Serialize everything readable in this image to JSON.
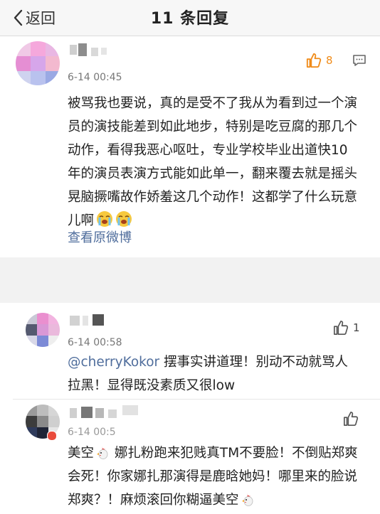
{
  "header": {
    "back_label": "返回",
    "title": "11 条回复"
  },
  "main_comment": {
    "time": "6-14 00:45",
    "likes": "8",
    "text": "被骂我也要说，真的是受不了我从为看到过一个演员的演技能差到如此地步，特别是吃豆腐的那几个动作，看得我恶心呕吐，专业学校毕业出道快10年的演员表演方式能如此单一，翻来覆去就是摇头晃脑撅嘴故作娇羞这几个动作！这都学了什么玩意儿啊",
    "view_original": "查看原微博"
  },
  "replies": [
    {
      "time": "6-14 00:58",
      "likes": "1",
      "mention": "@cherryKokor",
      "text": " 摆事实讲道理！别动不动就骂人拉黑！显得既没素质又很low"
    },
    {
      "time": "6-14 00:5",
      "likes": "",
      "text_a": "美空",
      "text_b": " 娜扎粉跑来犯贱真TM不要脸！不倒贴郑爽会死！你家娜扎那演得是鹿晗她妈！哪里来的脸说郑爽？！麻烦滚回你糊逼美空"
    }
  ],
  "colors": {
    "accent_orange": "#f08c1a",
    "link_blue": "#4f6d9c"
  },
  "icons": [
    "back-chevron-icon",
    "thumbs-up-icon",
    "comment-icon",
    "crying-emoji-icon",
    "rooster-emoji-icon"
  ]
}
